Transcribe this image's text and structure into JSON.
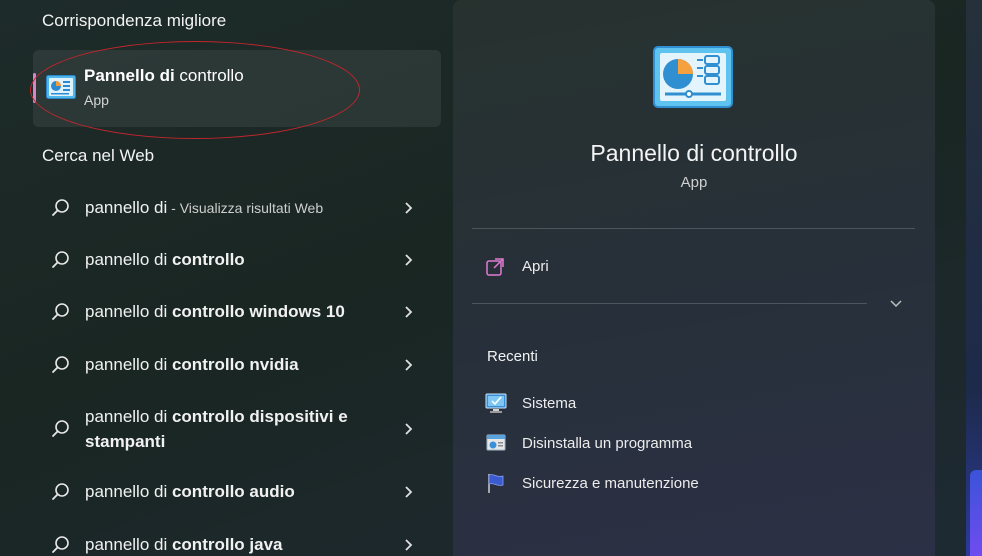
{
  "left": {
    "best_match_title": "Corrispondenza migliore",
    "best_match": {
      "name_bold": "Pannello di",
      "name_rest": " controllo",
      "type": "App",
      "icon": "control-panel-icon"
    },
    "web_title": "Cerca nel Web",
    "web_results": [
      {
        "prefix": "pannello di",
        "bold": "",
        "hint": " - Visualizza risultati Web"
      },
      {
        "prefix": "pannello di ",
        "bold": "controllo",
        "hint": ""
      },
      {
        "prefix": "pannello di ",
        "bold": "controllo windows 10",
        "hint": ""
      },
      {
        "prefix": "pannello di ",
        "bold": "controllo nvidia",
        "hint": ""
      },
      {
        "prefix": "pannello di ",
        "bold": "controllo dispositivi e",
        "line2": "stampanti",
        "hint": ""
      },
      {
        "prefix": "pannello di ",
        "bold": "controllo audio",
        "hint": ""
      },
      {
        "prefix": "pannello di ",
        "bold": "controllo java",
        "hint": ""
      }
    ]
  },
  "right": {
    "title": "Pannello di controllo",
    "subtitle": "App",
    "open_label": "Apri",
    "recent_title": "Recenti",
    "recent": [
      {
        "label": "Sistema",
        "icon": "system-icon"
      },
      {
        "label": "Disinstalla un programma",
        "icon": "programs-icon"
      },
      {
        "label": "Sicurezza e manutenzione",
        "icon": "security-flag-icon"
      }
    ]
  },
  "colors": {
    "accent_pink": "#d685c4",
    "annotation_red": "#c2262d",
    "icon_blue": "#4fb6ec"
  }
}
